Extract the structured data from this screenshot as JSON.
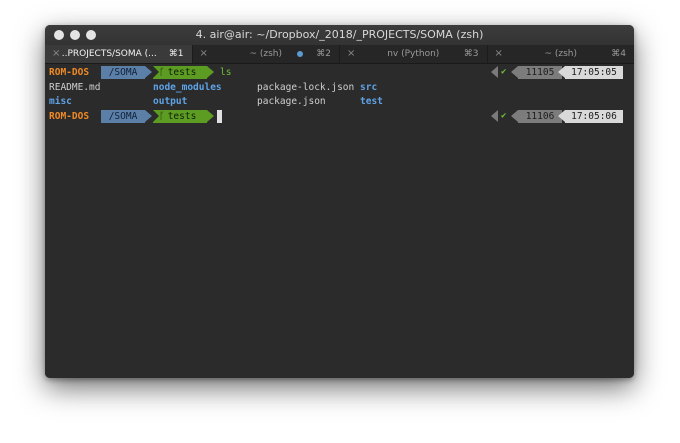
{
  "window": {
    "title": "4. air@air: ~/Dropbox/_2018/_PROJECTS/SOMA (zsh)"
  },
  "tabs": [
    {
      "label": "..PROJECTS/SOMA (...",
      "shortcut": "⌘1",
      "active": true
    },
    {
      "label": "~ (zsh)",
      "shortcut": "⌘2",
      "active": false,
      "has_activity_dot": true
    },
    {
      "label": "nv (Python)",
      "shortcut": "⌘3",
      "active": false
    },
    {
      "label": "~ (zsh)",
      "shortcut": "⌘4",
      "active": false
    }
  ],
  "icons": {
    "close": "×",
    "branch": "ᚴ",
    "check": "✔"
  },
  "prompts": [
    {
      "host": "ROM-DOS",
      "dir": "/SOMA",
      "branch": "tests",
      "command": "ls",
      "history": "11105",
      "time": "17:05:05"
    },
    {
      "host": "ROM-DOS",
      "dir": "/SOMA",
      "branch": "tests",
      "command": "",
      "history": "11106",
      "time": "17:05:06"
    }
  ],
  "ls_output": {
    "row1": [
      {
        "name": "README.md",
        "type": "file"
      },
      {
        "name": "node_modules",
        "type": "dir"
      },
      {
        "name": "package-lock.json",
        "type": "file"
      },
      {
        "name": "src",
        "type": "dir"
      }
    ],
    "row2": [
      {
        "name": "misc",
        "type": "dir"
      },
      {
        "name": "output",
        "type": "dir"
      },
      {
        "name": "package.json",
        "type": "file"
      },
      {
        "name": "test",
        "type": "dir"
      }
    ]
  },
  "colors": {
    "host": "#f08a24",
    "dir_segment": "#5b7fa6",
    "git_segment": "#5d9c22",
    "history_segment": "#7c7c7c",
    "time_segment": "#d9d9d9",
    "directory_listing": "#5ea3e6"
  }
}
